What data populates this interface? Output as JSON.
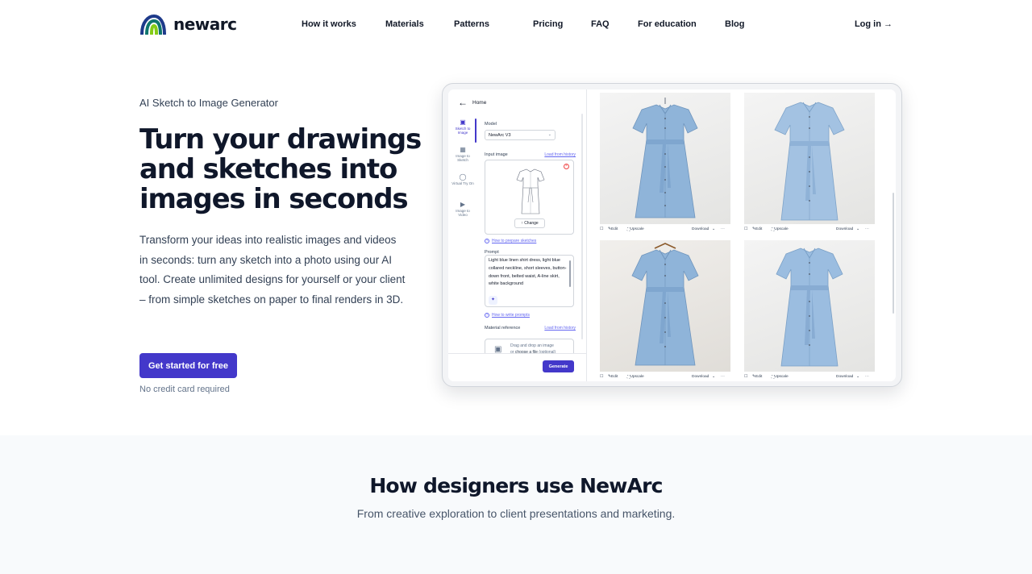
{
  "brand": {
    "name": "newarc",
    "colors": {
      "accent": "#4338ca",
      "logo_green": "#84cc16",
      "logo_teal": "#0f766e",
      "logo_blue": "#1e3a8a"
    }
  },
  "nav": {
    "items": [
      {
        "label": "How it works"
      },
      {
        "label": "Materials"
      },
      {
        "label": "Patterns"
      },
      {
        "label": "Pricing"
      },
      {
        "label": "FAQ"
      },
      {
        "label": "For education"
      },
      {
        "label": "Blog"
      }
    ],
    "login": "Log in →"
  },
  "hero": {
    "eyebrow": "AI Sketch to Image Generator",
    "title": "Turn your drawings and sketches into images in seconds",
    "description": "Transform your ideas into realistic images and videos in seconds: turn any sketch into a photo using our AI tool. Create unlimited designs for yourself or your client – from simple sketches on paper to final renders in 3D.",
    "cta": "Get started for free",
    "cta_note": "No credit card required"
  },
  "mockup": {
    "back_label": "Home",
    "rail": [
      {
        "icon": "image-icon",
        "label": "Sketch to Image",
        "active": true
      },
      {
        "icon": "sketch-icon",
        "label": "Image to Sketch",
        "active": false
      },
      {
        "icon": "person-icon",
        "label": "Virtual Try On",
        "active": false
      },
      {
        "icon": "video-icon",
        "label": "Image to Video",
        "active": false
      }
    ],
    "model_label": "Model",
    "model_value": "NewArc V3",
    "input_label": "Input image",
    "load_history": "Load from history",
    "change_label": "Change",
    "prepare_hint": "How to prepare sketches",
    "prompt_label": "Prompt",
    "prompt_text": "Light blue linen shirt dress, light blue collared neckline, short sleeves, button-down front, belted waist, A-line skirt, white background",
    "write_hint": "How to write prompts",
    "material_label": "Material reference",
    "material_history": "Load from history",
    "dropzone_line1": "Drag and drop an image",
    "dropzone_or": "or",
    "dropzone_link": "choose a file",
    "dropzone_optional": "(optional)",
    "generate": "Generate",
    "results": [
      {
        "edit": "Edit",
        "upscale": "Upscale",
        "download": "Download",
        "more": "···"
      },
      {
        "edit": "Edit",
        "upscale": "Upscale",
        "download": "Download",
        "more": "···"
      },
      {
        "edit": "Edit",
        "upscale": "Upscale",
        "download": "Download",
        "more": "···"
      },
      {
        "edit": "Edit",
        "upscale": "Upscale",
        "download": "Download",
        "more": "···"
      }
    ]
  },
  "section2": {
    "title": "How designers use NewArc",
    "subtitle": "From creative exploration to client presentations and marketing."
  }
}
